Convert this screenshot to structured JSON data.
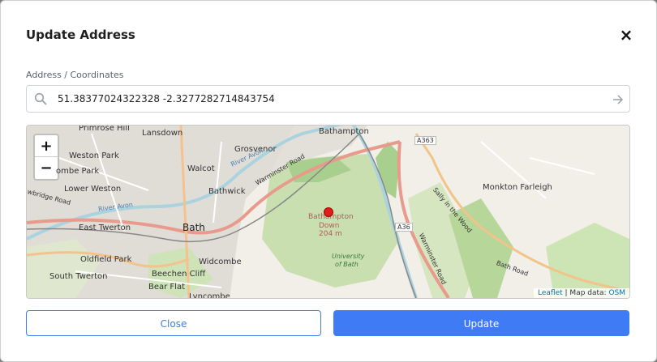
{
  "modal": {
    "title": "Update Address",
    "close_symbol": "×"
  },
  "address": {
    "label": "Address / Coordinates",
    "value": "51.38377024322328 -2.3277282714843754",
    "search_icon": "search-icon",
    "submit_icon": "arrow-right-icon"
  },
  "map": {
    "zoom_in": "+",
    "zoom_out": "−",
    "labels": {
      "primrose_hill": "Primrose Hill",
      "lansdown": "Lansdown",
      "bathampton": "Bathampton",
      "grosvenor": "Grosvenor",
      "weston_park": "Weston Park",
      "combe_park": "ombe Park",
      "walcot": "Walcot",
      "lower_weston": "Lower Weston",
      "bathwick": "Bathwick",
      "bath": "Bath",
      "east_twerton": "East Twerton",
      "oldfield_park": "Oldfield Park",
      "widcombe": "Widcombe",
      "south_twerton": "South Twerton",
      "beechen_cliff": "Beechen Cliff",
      "bear_flat": "Bear Flat",
      "lyncombe": "Lyncombe",
      "monkton_farleigh": "Monkton Farleigh",
      "bathampton_down": "Bathampton",
      "bathampton_down2": "Down",
      "elevation": "204 m",
      "university": "University",
      "university2": "of Bath",
      "a363": "A363",
      "a36": "A36",
      "warminster_road": "Warminster Road",
      "warminster_road2": "Warminster Road",
      "bath_road": "Bath Road",
      "sally_in_the_wood": "Sally in the Wood",
      "river_avon": "River Avon",
      "river_avon2": "River Avon",
      "newbridge_road": "wbridge Road"
    },
    "attribution": {
      "leaflet": "Leaflet",
      "sep": " | Map data: ",
      "osm": "OSM"
    }
  },
  "buttons": {
    "close": "Close",
    "update": "Update"
  },
  "colors": {
    "primary": "#3f7bf5",
    "marker": "#e21b1b"
  }
}
